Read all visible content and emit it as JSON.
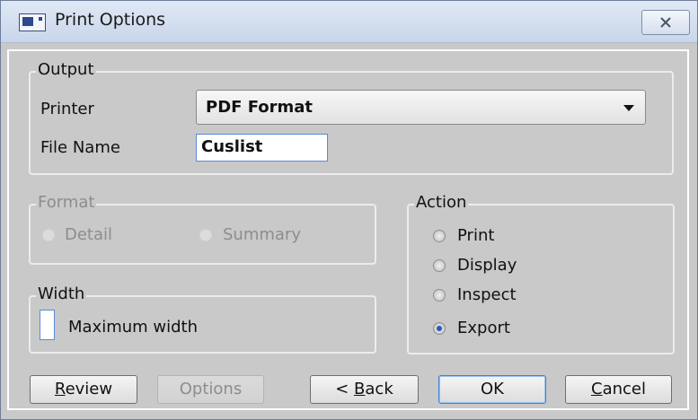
{
  "window": {
    "title": "Print Options",
    "icon": "print-window-icon",
    "close_icon": "close-icon"
  },
  "output": {
    "legend": "Output",
    "printer_label": "Printer",
    "printer_value": "PDF Format",
    "file_name_label": "File Name",
    "file_name_value": "Cuslist"
  },
  "format": {
    "legend": "Format",
    "options": [
      {
        "label": "Detail",
        "selected": false,
        "enabled": false
      },
      {
        "label": "Summary",
        "selected": false,
        "enabled": false
      }
    ]
  },
  "width": {
    "legend": "Width",
    "checkbox_label": "Maximum width",
    "checked": false
  },
  "action": {
    "legend": "Action",
    "options": [
      {
        "label": "Print",
        "selected": false
      },
      {
        "label": "Display",
        "selected": false
      },
      {
        "label": "Inspect",
        "selected": false
      },
      {
        "label": "Export",
        "selected": true
      }
    ]
  },
  "buttons": {
    "review": {
      "pre": "",
      "u": "R",
      "post": "eview"
    },
    "options": "Options",
    "back": {
      "pre": "< ",
      "u": "B",
      "post": "ack"
    },
    "ok": "OK",
    "cancel": {
      "pre": "",
      "u": "C",
      "post": "ancel"
    }
  }
}
